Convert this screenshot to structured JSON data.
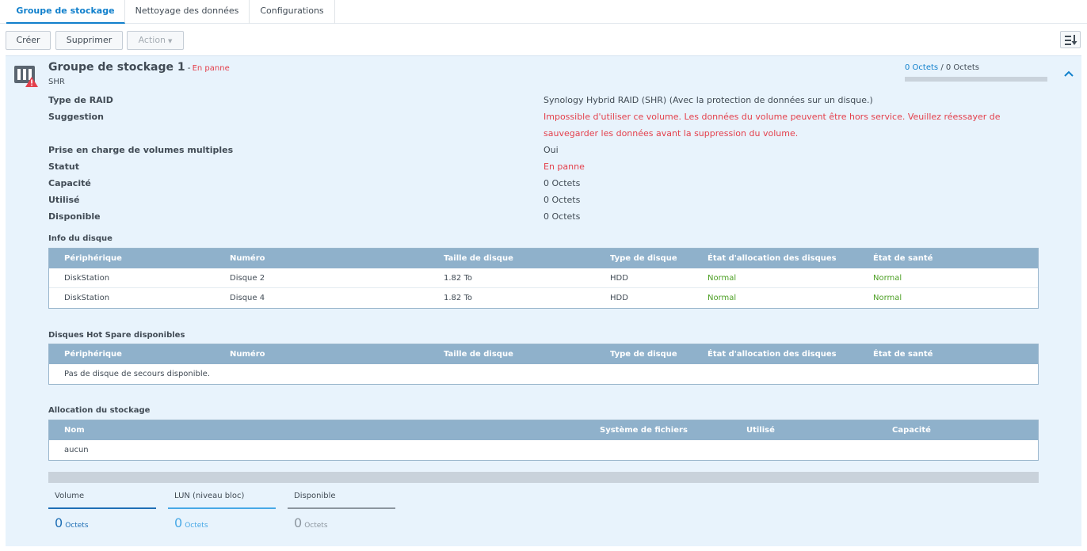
{
  "tabs": [
    {
      "label": "Groupe de stockage",
      "active": true
    },
    {
      "label": "Nettoyage des données",
      "active": false
    },
    {
      "label": "Configurations",
      "active": false
    }
  ],
  "toolbar": {
    "create_label": "Créer",
    "delete_label": "Supprimer",
    "action_label": "Action",
    "sort_icon": "sort-list-icon"
  },
  "pool": {
    "title": "Groupe de stockage 1",
    "separator": "-",
    "state": "En panne",
    "type_short": "SHR",
    "usage_used": "0 Octets",
    "usage_separator": "/",
    "usage_total": "0 Octets",
    "usage_fraction": 0,
    "icon": "storage-pool-warning-icon"
  },
  "props": [
    {
      "label": "Type de RAID",
      "value": "Synology Hybrid RAID (SHR) (Avec la protection de données sur un disque.)"
    },
    {
      "label": "Suggestion",
      "value": "Impossible d'utiliser ce volume. Les données du volume peuvent être hors service. Veuillez réessayer de",
      "value2": "sauvegarder les données avant la suppression du volume."
    },
    {
      "label": "Prise en charge de volumes multiples",
      "value": "Oui"
    },
    {
      "label": "Statut",
      "value": "En panne"
    },
    {
      "label": "Capacité",
      "value": "0 Octets"
    },
    {
      "label": "Utilisé",
      "value": "0 Octets"
    },
    {
      "label": "Disponible",
      "value": "0 Octets"
    }
  ],
  "disk_info": {
    "title": "Info du disque",
    "headers": [
      "Périphérique",
      "Numéro",
      "Taille de disque",
      "Type de disque",
      "État d'allocation des disques",
      "État de santé"
    ],
    "rows": [
      [
        "DiskStation",
        "Disque 2",
        "1.82 To",
        "HDD",
        "Normal",
        "Normal"
      ],
      [
        "DiskStation",
        "Disque 4",
        "1.82 To",
        "HDD",
        "Normal",
        "Normal"
      ]
    ]
  },
  "hot_spare": {
    "title": "Disques Hot Spare disponibles",
    "headers": [
      "Périphérique",
      "Numéro",
      "Taille de disque",
      "Type de disque",
      "État d'allocation des disques",
      "État de santé"
    ],
    "empty_text": "Pas de disque de secours disponible."
  },
  "allocation": {
    "title": "Allocation du stockage",
    "headers": [
      "Nom",
      "Système de fichiers",
      "Utilisé",
      "Capacité"
    ],
    "rows": [
      [
        "aucun",
        "",
        "",
        ""
      ]
    ]
  },
  "summary": [
    {
      "label": "Volume",
      "value": "0",
      "unit": "Octets",
      "color": "#1f6fb5"
    },
    {
      "label": "LUN (niveau bloc)",
      "value": "0",
      "unit": "Octets",
      "color": "#48a9e6"
    },
    {
      "label": "Disponible",
      "value": "0",
      "unit": "Octets",
      "color": "#8c969f"
    }
  ],
  "colors": {
    "accent": "#1180cc",
    "error": "#e4404c",
    "ok": "#4c9f24",
    "table_header": "#8fb1cb",
    "panel_bg": "#e8f3fc"
  }
}
